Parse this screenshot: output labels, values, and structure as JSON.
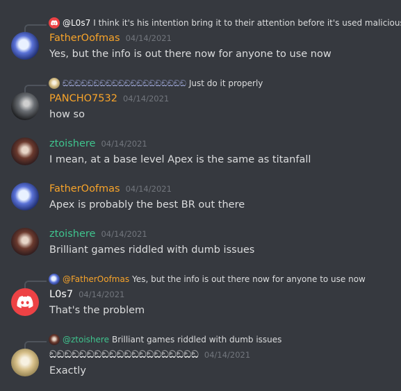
{
  "colors": {
    "background": "#36393f",
    "orange_user": "#f8a42a",
    "green_user": "#3fc48e",
    "white_user": "#ffffff",
    "timestamp": "#72767d",
    "message_text": "#dcddde",
    "discord_red": "#ed4245"
  },
  "messages": [
    {
      "reply": {
        "avatar": "discord-logo-icon",
        "name": "@L0s7",
        "text": "I think it's his intention bring it to their attention before it's used maliciously"
      },
      "avatar": "user-avatar-fatheroofmas",
      "username": "FatherOofmas",
      "timestamp": "04/14/2021",
      "text": "Yes, but the info is out there now for anyone to use now"
    },
    {
      "reply": {
        "avatar": "user-avatar-blonde",
        "name": "ඞඞඞඞඞඞඞඞඞඞඞඞඞඞඞඞඞඞඞඞ",
        "text": "Just do it properly"
      },
      "avatar": "user-avatar-pancho",
      "username": "PANCHO7532",
      "timestamp": "04/14/2021",
      "text": "how so"
    },
    {
      "avatar": "user-avatar-ztoishere",
      "username": "ztoishere",
      "timestamp": "04/14/2021",
      "text": "I mean, at a base level Apex is the same as titanfall"
    },
    {
      "avatar": "user-avatar-fatheroofmas",
      "username": "FatherOofmas",
      "timestamp": "04/14/2021",
      "text": "Apex is probably the best BR out there"
    },
    {
      "avatar": "user-avatar-ztoishere",
      "username": "ztoishere",
      "timestamp": "04/14/2021",
      "text": "Brilliant games riddled with dumb issues"
    },
    {
      "reply": {
        "avatar": "user-avatar-fatheroofmas",
        "name": "@FatherOofmas",
        "text": "Yes, but the info is out there now for anyone to use now"
      },
      "avatar": "discord-logo-icon",
      "username": "L0s7",
      "timestamp": "04/14/2021",
      "text": "That's the problem"
    },
    {
      "reply": {
        "avatar": "user-avatar-ztoishere",
        "name": "@ztoishere",
        "text": "Brilliant games riddled with dumb issues"
      },
      "avatar": "user-avatar-blonde",
      "username": "ඞඞඞඞඞඞඞඞඞඞඞඞඞඞඞඞඞඞඞඞ",
      "timestamp": "04/14/2021",
      "text": "Exactly"
    }
  ]
}
